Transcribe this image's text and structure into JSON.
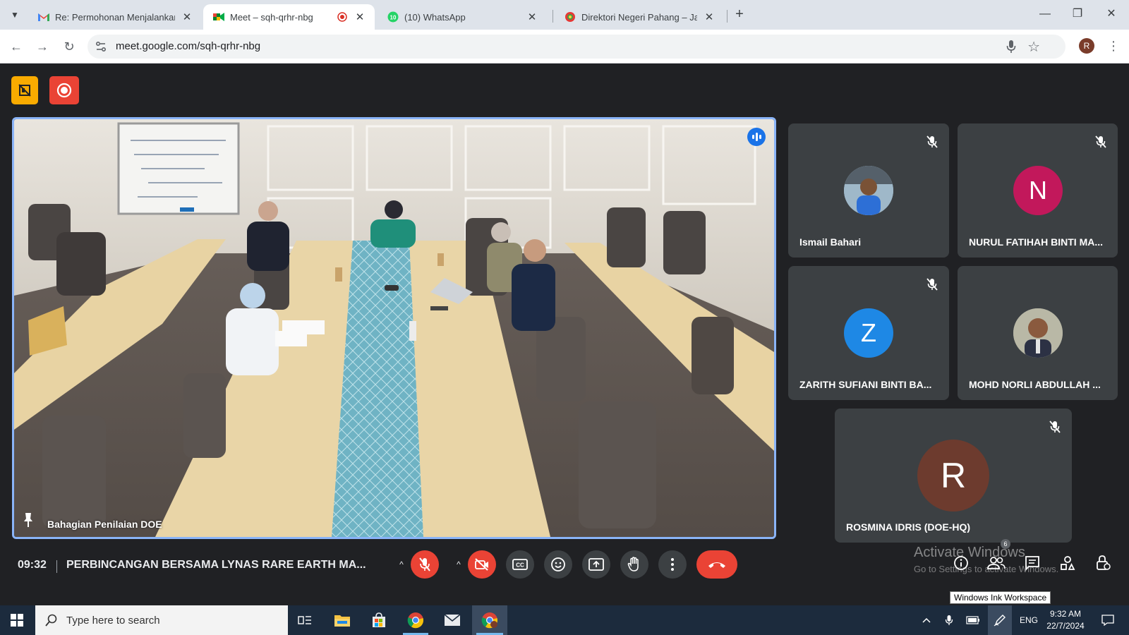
{
  "browser": {
    "tabs": [
      {
        "title": "Re: Permohonan Menjalankan K",
        "icon": "gmail-icon",
        "active": false
      },
      {
        "title": "Meet – sqh-qrhr-nbg",
        "icon": "meet-icon",
        "active": true
      },
      {
        "title": "(10) WhatsApp",
        "icon": "whatsapp-icon",
        "active": false,
        "badge": "10"
      },
      {
        "title": "Direktori Negeri Pahang – Jabat",
        "icon": "site-icon",
        "active": false
      }
    ],
    "url": "meet.google.com/sqh-qrhr-nbg",
    "profile_initial": "R"
  },
  "meet": {
    "main_video": {
      "name": "Bahagian Penilaian DOE"
    },
    "participants": [
      {
        "name": "Ismail Bahari",
        "avatar": "photo",
        "muted": true
      },
      {
        "name": "NURUL FATIHAH BINTI MA...",
        "avatar_letter": "N",
        "avatar_color": "#c2185b",
        "muted": true
      },
      {
        "name": "ZARITH SUFIANI BINTI BA...",
        "avatar_letter": "Z",
        "avatar_color": "#1e88e5",
        "muted": true
      },
      {
        "name": "MOHD NORLI ABDULLAH ...",
        "avatar": "photo",
        "muted": false
      },
      {
        "name": "ROSMINA IDRIS (DOE-HQ)",
        "avatar_letter": "R",
        "avatar_color": "#6d3b2e",
        "muted": true
      }
    ],
    "time": "09:32",
    "meeting_title": "PERBINCANGAN BERSAMA LYNAS RARE EARTH MA...",
    "people_count": "6",
    "colors": {
      "accent": "#8ab4f8",
      "danger": "#ea4335",
      "tile": "#3c4043",
      "bg": "#202124"
    }
  },
  "overlay": {
    "activate_title": "Activate Windows",
    "activate_sub": "Go to Settings to activate Windows.",
    "tooltip": "Windows Ink Workspace"
  },
  "taskbar": {
    "search_placeholder": "Type here to search",
    "language": "ENG",
    "time": "9:32 AM",
    "date": "22/7/2024"
  }
}
